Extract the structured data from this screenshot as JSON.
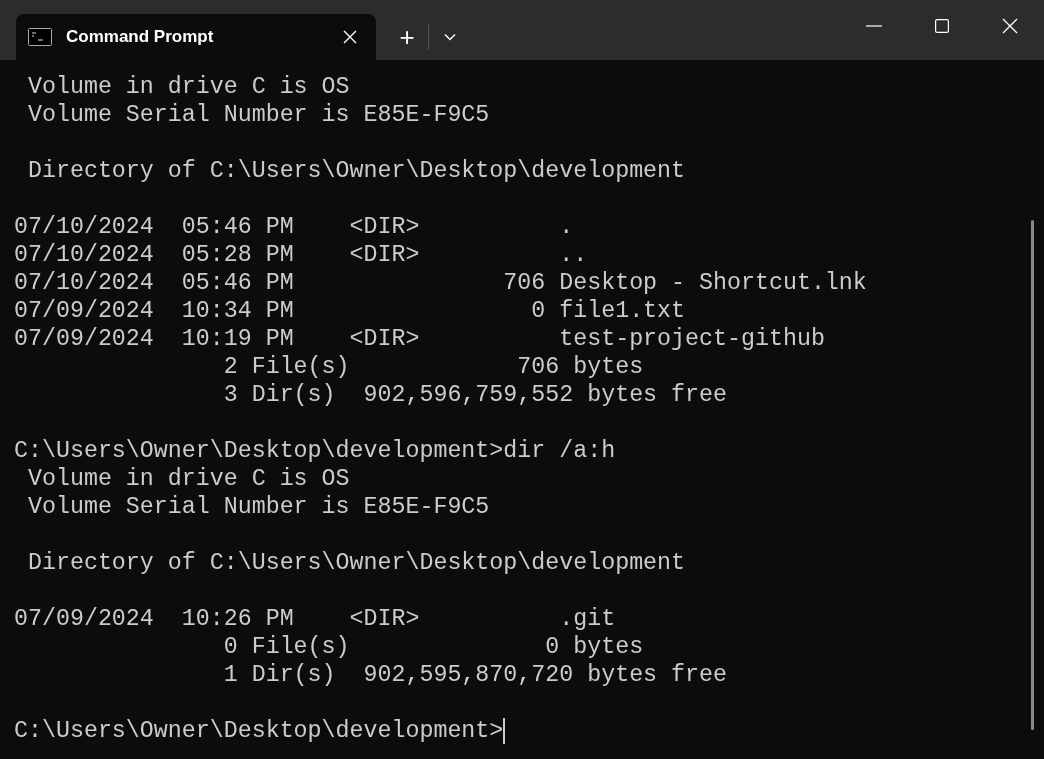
{
  "window": {
    "tab_title": "Command Prompt",
    "new_tab": "+"
  },
  "terminal": {
    "blocks": [
      [
        " Volume in drive C is OS",
        " Volume Serial Number is E85E-F9C5"
      ],
      [
        " Directory of C:\\Users\\Owner\\Desktop\\development"
      ],
      [
        "07/10/2024  05:46 PM    <DIR>          .",
        "07/10/2024  05:28 PM    <DIR>          ..",
        "07/10/2024  05:46 PM               706 Desktop - Shortcut.lnk",
        "07/09/2024  10:34 PM                 0 file1.txt",
        "07/09/2024  10:19 PM    <DIR>          test-project-github",
        "               2 File(s)            706 bytes",
        "               3 Dir(s)  902,596,759,552 bytes free"
      ],
      [
        "C:\\Users\\Owner\\Desktop\\development>dir /a:h",
        " Volume in drive C is OS",
        " Volume Serial Number is E85E-F9C5"
      ],
      [
        " Directory of C:\\Users\\Owner\\Desktop\\development"
      ],
      [
        "07/09/2024  10:26 PM    <DIR>          .git",
        "               0 File(s)              0 bytes",
        "               1 Dir(s)  902,595,870,720 bytes free"
      ]
    ],
    "prompt": "C:\\Users\\Owner\\Desktop\\development>"
  }
}
